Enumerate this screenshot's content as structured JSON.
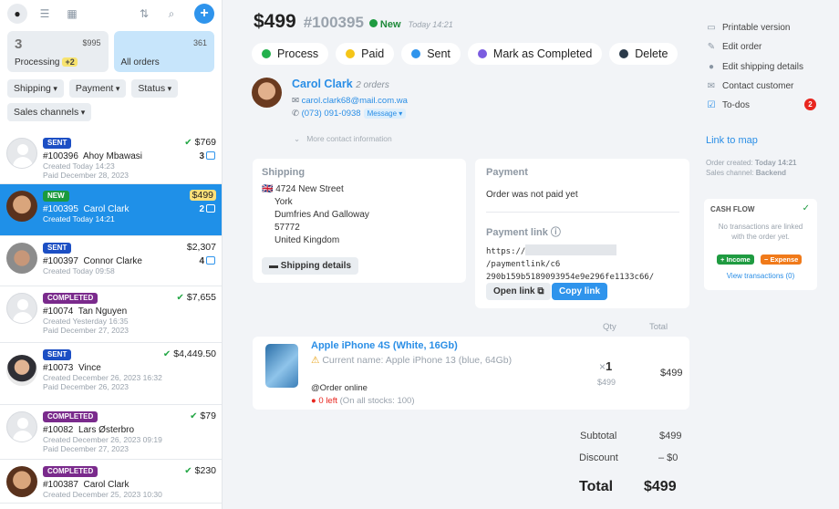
{
  "toolbar": {
    "icons": [
      "user-icon",
      "list-icon",
      "grid-icon",
      "sort-icon",
      "search-icon",
      "plus-icon"
    ]
  },
  "stats": {
    "processing": {
      "count": "3",
      "amount": "$995",
      "label": "Processing",
      "badge": "+2"
    },
    "all": {
      "label": "All orders",
      "count": "361"
    }
  },
  "filters": [
    "Shipping",
    "Payment",
    "Status",
    "Sales channels"
  ],
  "orders": [
    {
      "status": "SENT",
      "status_class": "sent",
      "amount": "$769",
      "check": true,
      "number": "#100396",
      "name": "Ahoy Mbawasi",
      "count": "3",
      "meta1": "Created Today 14:23",
      "meta2": "Paid December 28, 2023",
      "avatar": "gray"
    },
    {
      "status": "NEW",
      "status_class": "new",
      "amount": "$499",
      "check": false,
      "number": "#100395",
      "name": "Carol Clark",
      "count": "2",
      "meta1": "Created Today 14:21",
      "meta2": "",
      "avatar": "ph1",
      "selected": true
    },
    {
      "status": "SENT",
      "status_class": "sent",
      "amount": "$2,307",
      "check": false,
      "number": "#100397",
      "name": "Connor Clarke",
      "count": "4",
      "meta1": "Created Today 09:58",
      "meta2": "",
      "avatar": "ph2"
    },
    {
      "status": "COMPLETED",
      "status_class": "completed",
      "amount": "$7,655",
      "check": true,
      "number": "#10074",
      "name": "Tan Nguyen",
      "count": "",
      "meta1": "Created Yesterday 16:35",
      "meta2": "Paid December 27, 2023",
      "avatar": "gray"
    },
    {
      "status": "SENT",
      "status_class": "sent",
      "amount": "$4,449.50",
      "check": true,
      "number": "#10073",
      "name": "Vince",
      "count": "",
      "meta1": "Created December 26, 2023 16:32",
      "meta2": "Paid December 26, 2023",
      "avatar": "ph3"
    },
    {
      "status": "COMPLETED",
      "status_class": "completed",
      "amount": "$79",
      "check": true,
      "number": "#10082",
      "name": "Lars Østerbro",
      "count": "",
      "meta1": "Created December 26, 2023 09:19",
      "meta2": "Paid December 27, 2023",
      "avatar": "gray"
    },
    {
      "status": "COMPLETED",
      "status_class": "completed",
      "amount": "$230",
      "check": true,
      "number": "#100387",
      "name": "Carol Clark",
      "count": "",
      "meta1": "Created December 25, 2023 10:30",
      "meta2": "",
      "avatar": "ph1"
    }
  ],
  "order": {
    "price": "$499",
    "number": "#100395",
    "status": "New",
    "date": "Today 14:21"
  },
  "actions": [
    {
      "label": "Process",
      "color": "#22b14c"
    },
    {
      "label": "Paid",
      "color": "#f5c518"
    },
    {
      "label": "Sent",
      "color": "#2f94ec"
    },
    {
      "label": "Mark as Completed",
      "color": "#7b5ce0"
    },
    {
      "label": "Delete",
      "color": "#2b3a4a"
    }
  ],
  "customer": {
    "name": "Carol Clark",
    "orders": "2 orders",
    "email": "carol.clark68@mail.com.wa",
    "phone": "(073) 091-0938",
    "message": "Message",
    "more": "More contact information"
  },
  "shipping": {
    "title": "Shipping",
    "flag": "🇬🇧",
    "lines": [
      "4724 New Street",
      "York",
      "Dumfries And Galloway",
      "57772",
      "United Kingdom"
    ],
    "button": "Shipping details"
  },
  "payment": {
    "title": "Payment",
    "status": "Order was not paid yet",
    "link_title": "Payment link",
    "link_start": "https://",
    "link_end": "/paymentlink/c6",
    "link_line2": "290b159b5189093954e9e296fe1133c66/",
    "open": "Open link",
    "copy": "Copy link"
  },
  "items_header": {
    "qty": "Qty",
    "total": "Total"
  },
  "item": {
    "name": "Apple iPhone 4S (White, 16Gb)",
    "warning": "Current name: Apple iPhone 13 (blue, 64Gb)",
    "source": "@Order online",
    "stock": "0 left",
    "stock_note": "(On all stocks: 100)",
    "qty_x": "×",
    "qty": "1",
    "unit": "$499",
    "total": "$499"
  },
  "summary": {
    "subtotal_label": "Subtotal",
    "subtotal": "$499",
    "discount_label": "Discount",
    "discount": "– $0",
    "total_label": "Total",
    "total": "$499"
  },
  "sidepanel": {
    "printable": "Printable version",
    "edit": "Edit order",
    "edit_ship": "Edit shipping details",
    "contact": "Contact customer",
    "todos": "To-dos",
    "todos_count": "2",
    "map": "Link to map",
    "created_label": "Order created:",
    "created": "Today 14:21",
    "channel_label": "Sales channel:",
    "channel": "Backend"
  },
  "cashflow": {
    "title": "CASH FLOW",
    "empty": "No transactions are linked with the order yet.",
    "income": "Income",
    "expense": "Expense",
    "view": "View transactions (0)"
  }
}
